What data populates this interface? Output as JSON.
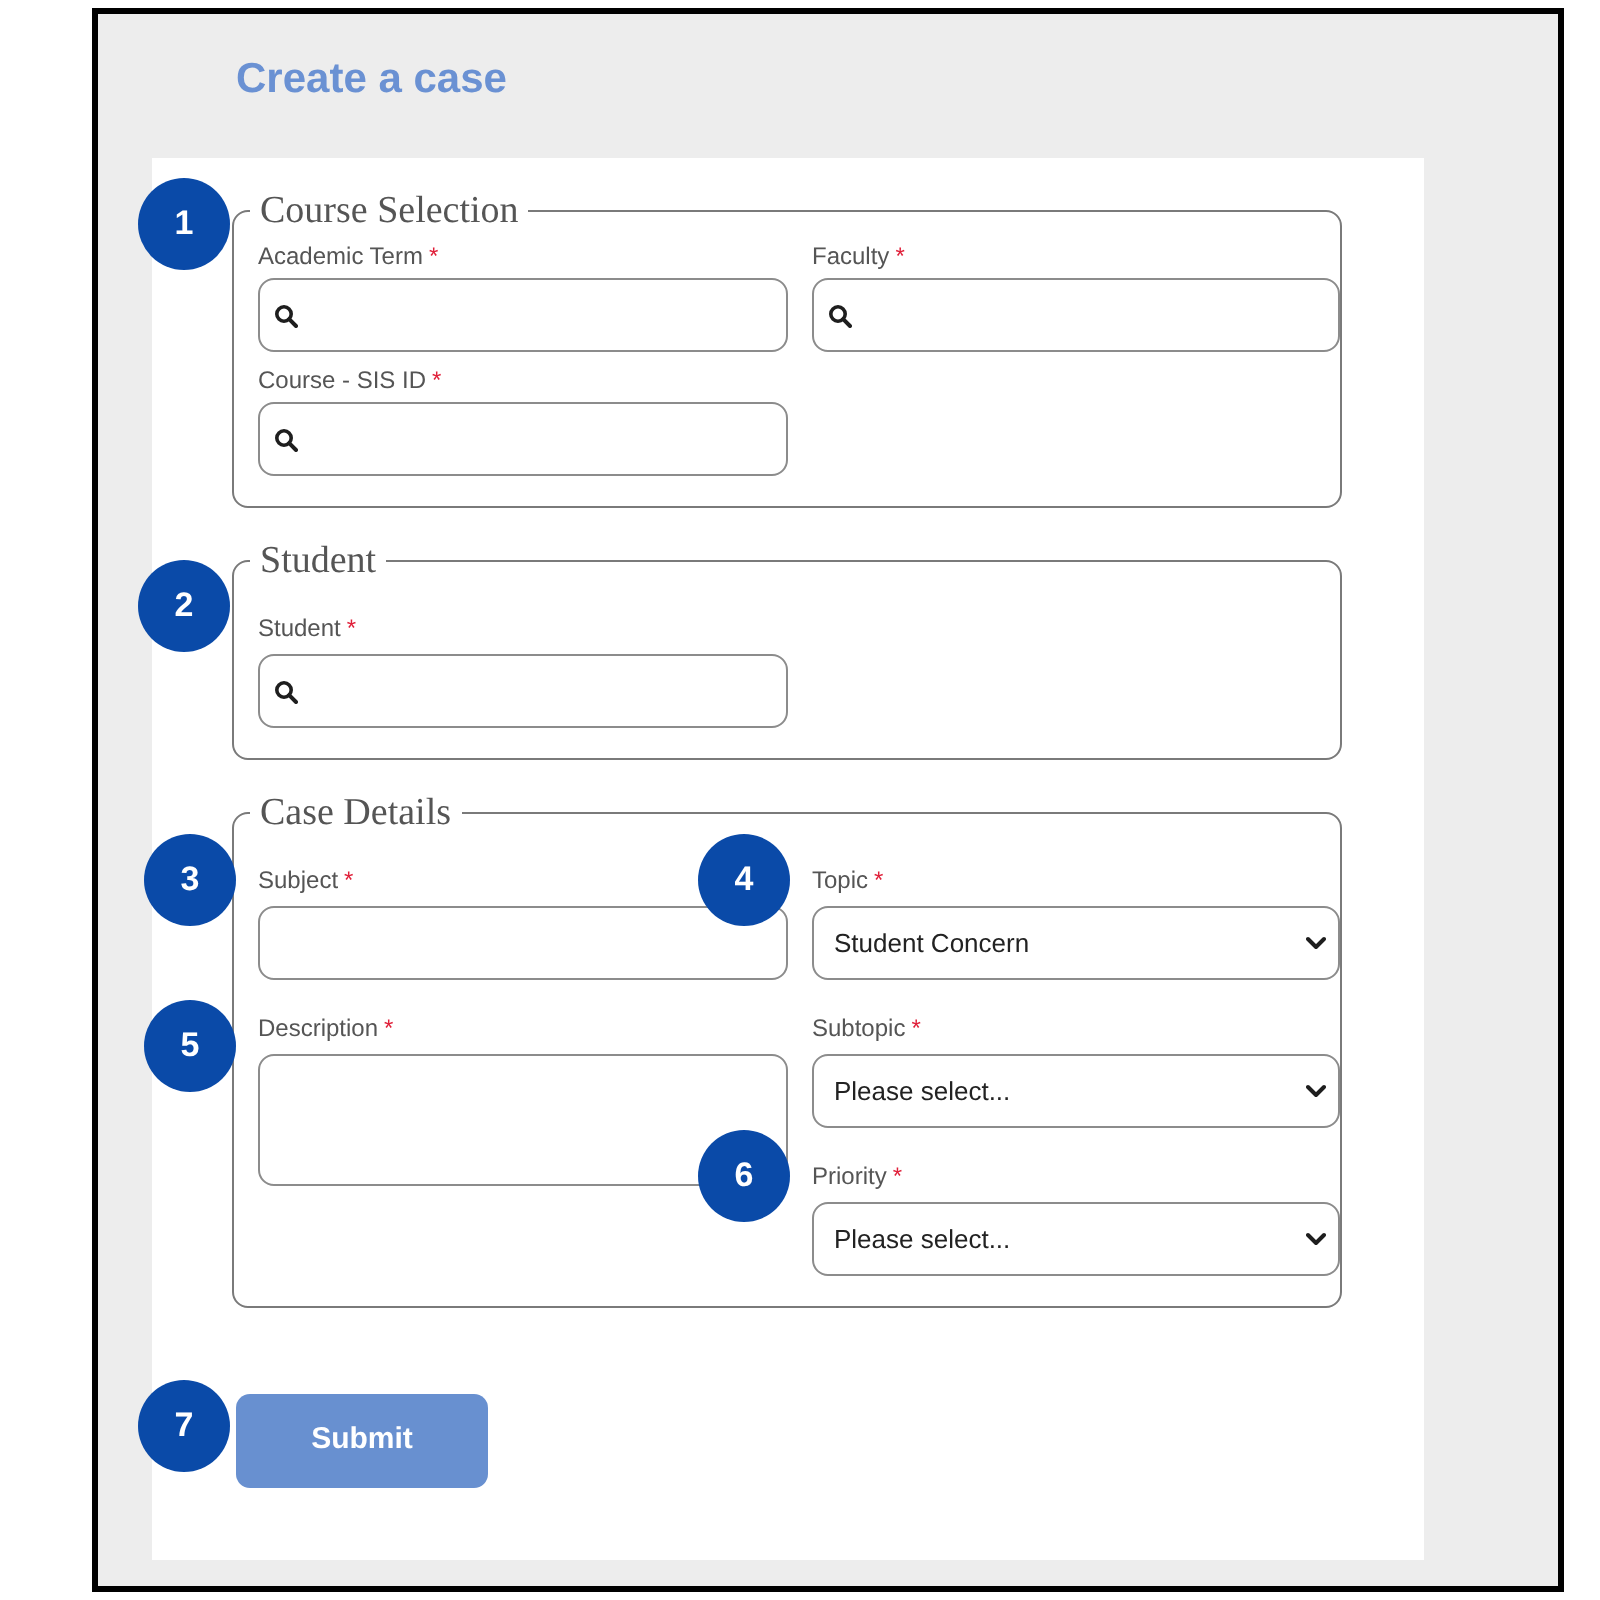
{
  "page": {
    "title": "Create a case"
  },
  "sections": [
    {
      "legend": "Course Selection",
      "step": "1",
      "fields": [
        {
          "kind": "lookup",
          "label": "Academic Term",
          "required_mark": "*"
        },
        {
          "kind": "lookup",
          "label": "Faculty",
          "required_mark": "*"
        },
        {
          "kind": "lookup",
          "label": "Course - SIS ID",
          "required_mark": "*"
        }
      ]
    },
    {
      "legend": "Student",
      "step": "2",
      "fields": [
        {
          "kind": "lookup",
          "label": "Student",
          "required_mark": "*"
        }
      ]
    },
    {
      "legend": "Case Details",
      "fields": [
        {
          "kind": "text",
          "label": "Subject",
          "required_mark": "*",
          "step": "3"
        },
        {
          "kind": "select",
          "label": "Topic",
          "required_mark": "*",
          "value": "Student Concern",
          "step": "4"
        },
        {
          "kind": "textarea",
          "label": "Description",
          "required_mark": "*",
          "step": "5"
        },
        {
          "kind": "select",
          "label": "Subtopic",
          "required_mark": "*",
          "value": "Please select..."
        },
        {
          "kind": "select",
          "label": "Priority",
          "required_mark": "*",
          "value": "Please select...",
          "step": "6"
        }
      ]
    }
  ],
  "submit": {
    "label": "Submit",
    "step": "7"
  }
}
